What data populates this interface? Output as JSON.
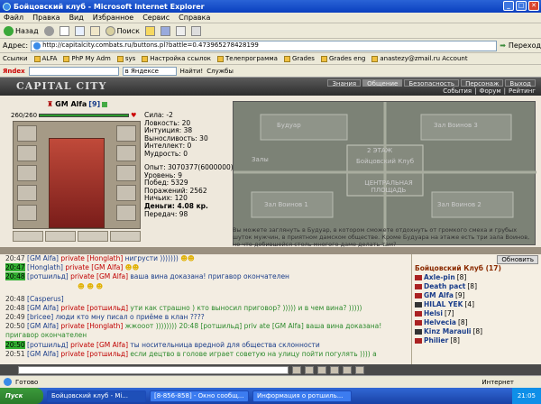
{
  "window": {
    "title": "Бойцовский клуб - Microsoft Internet Explorer"
  },
  "menu": [
    "Файл",
    "Правка",
    "Вид",
    "Избранное",
    "Сервис",
    "Справка"
  ],
  "toolbar": {
    "back": "Назад",
    "search": "Поиск"
  },
  "address": {
    "label": "Адрес:",
    "url": "http://capitalcity.combats.ru/buttons.pl?battle=0.473965278428199",
    "go": "Переход"
  },
  "links": {
    "label": "Ссылки",
    "items": [
      "ALFA",
      "PhP My Adm",
      "sys",
      "Настройка ссылок",
      "Телепрограмма",
      "Grades",
      "Grades eng",
      "anastezy@zmail.ru Account"
    ]
  },
  "yandexbar": {
    "brand": "Яndex",
    "dropdown": "в Яндексе",
    "find": "Найти!",
    "services": "Службы"
  },
  "game": {
    "logo": "CAPITAL CITY",
    "nav_top": [
      "Знания",
      "Общение",
      "Безопасность",
      "Персонаж",
      "Выход"
    ],
    "nav_bottom": [
      "События",
      "Форум",
      "Рейтинг"
    ],
    "character": {
      "name": "GM Alfa",
      "level": "[9]",
      "hp": "260/260"
    },
    "stats": [
      "Сила: -2",
      "Ловкость: 20",
      "Интуиция: 38",
      "Выносливость: 30",
      "Интеллект: 0",
      "Мудрость: 0"
    ],
    "stats2": [
      "Опыт: 3070377(6000000)",
      "Уровень: 9",
      "Побед: 5329",
      "Поражений: 2562",
      "Ничьих: 120",
      "Деньги: 4.08 кр.",
      "Передач: 98"
    ],
    "map": {
      "rooms": [
        "Будуар",
        "Зал Воинов 1",
        "Зал Воинов 2",
        "Зал Воинов 3",
        "Залы",
        "2 ЭТАЖ",
        "Бойцовский Клуб",
        "ЦЕНТРАЛЬНАЯ ПЛОЩАДЬ"
      ]
    },
    "map_text": "Вы можете заглянуть в Будуар, в котором сможете отдохнуть от громкого смеха и грубых шуток мужчин, в приятном дамском обществе. Кроме Будуара на этаже есть три зала Воинов, но что добившейся столь многого даме делать там?",
    "chat": [
      {
        "time": "20:47",
        "hl": false,
        "nick": "[GM Alfa]",
        "pv": "private [Honglath]",
        "msg": "нигрусти )))))))"
      },
      {
        "time": "20:47",
        "hl": true,
        "nick": "[Honglath]",
        "pv": "private [GM Alfa]",
        "msg": ""
      },
      {
        "time": "20:48",
        "hl": true,
        "nick": "[ротшильд]",
        "pv": "private [GM Alfa]",
        "msg": "ваша вина доказана! пригавор окончателен"
      },
      {
        "time": "",
        "hl": false,
        "nick": "",
        "pv": "",
        "msg": ""
      },
      {
        "time": "20:48",
        "hl": false,
        "nick": "[Casperus]",
        "pv": "",
        "msg": ""
      },
      {
        "time": "20:48",
        "hl": false,
        "nick": "[GM Alfa]",
        "pv": "private [ротшильд]",
        "msg": "ути как страшно ) кто выносил приговор? ))))) и в чем вина? )))))"
      },
      {
        "time": "20:49",
        "hl": false,
        "nick": "[bricee]",
        "pv": "",
        "msg": "люди кто мну писал о приёме в клан ????"
      },
      {
        "time": "20:50",
        "hl": false,
        "nick": "[GM Alfa]",
        "pv": "private [Honglath]",
        "msg": "жжооот )))))))) 20:48 [ротшильд] priv ate [GM Alfa] ваша вина доказана! пригавор окончателен"
      },
      {
        "time": "20:50",
        "hl": true,
        "nick": "[ротшильд]",
        "pv": "private [GM Alfa]",
        "msg": "ты носительница вредной для общества склонности"
      },
      {
        "time": "20:51",
        "hl": false,
        "nick": "[GM Alfa]",
        "pv": "private [ротшильд]",
        "msg": "если децтво в голове играет советую на улицу пойти погулять )))) а"
      }
    ],
    "who": {
      "refresh": "Обновить",
      "title": "Бойцовский Клуб (17)",
      "users": [
        {
          "name": "Axle-pin",
          "lvl": "[8]"
        },
        {
          "name": "Death pact",
          "lvl": "[8]"
        },
        {
          "name": "GM Alfa",
          "lvl": "[9]"
        },
        {
          "name": "HILAL YEK",
          "lvl": "[4]"
        },
        {
          "name": "Helsi",
          "lvl": "[7]"
        },
        {
          "name": "Helvecia",
          "lvl": "[8]"
        },
        {
          "name": "Kinz Marauli",
          "lvl": "[8]"
        },
        {
          "name": "Philier",
          "lvl": "[8]"
        }
      ]
    }
  },
  "statusbar": {
    "text": "Готово",
    "zone": "Интернет"
  },
  "taskbar": {
    "start": "Пуск",
    "tasks": [
      "Бойцовский клуб - Mi...",
      "[8-856-858] - Окно сообщ...",
      "Информация о ротшиль..."
    ],
    "clock": "21:05"
  }
}
